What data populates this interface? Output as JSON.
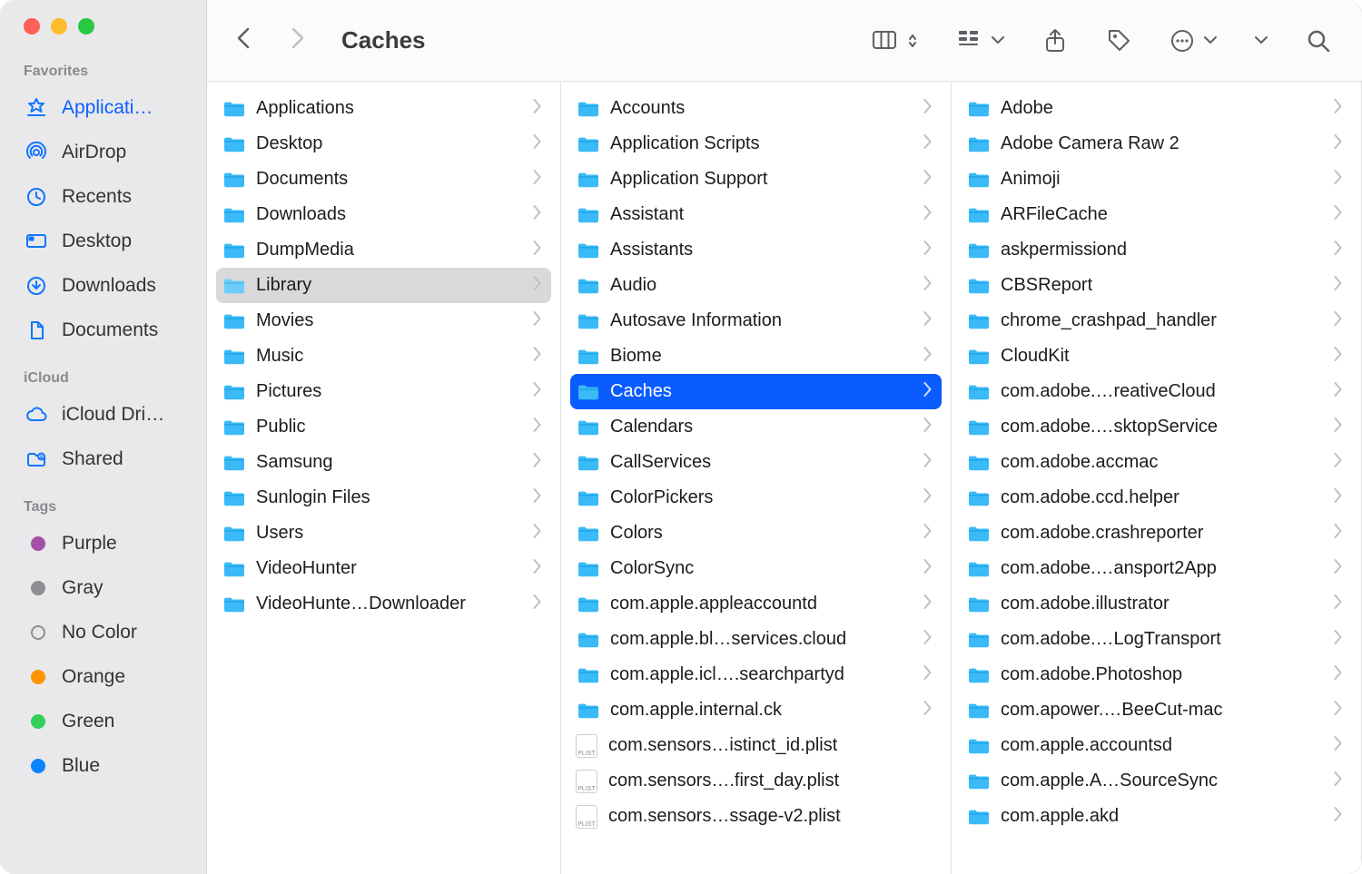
{
  "window": {
    "title": "Caches"
  },
  "colors": {
    "accent": "#0a5cff",
    "sidebar_icon": "#1276ff",
    "folder": "#3abaf7",
    "folder_shadow": "#12a0e6"
  },
  "sidebar": {
    "favorites_title": "Favorites",
    "favorites": [
      {
        "icon": "app-store",
        "label": "Applicati…",
        "selected": true
      },
      {
        "icon": "airdrop",
        "label": "AirDrop"
      },
      {
        "icon": "recents",
        "label": "Recents"
      },
      {
        "icon": "desktop",
        "label": "Desktop"
      },
      {
        "icon": "downloads",
        "label": "Downloads"
      },
      {
        "icon": "documents",
        "label": "Documents"
      }
    ],
    "icloud_title": "iCloud",
    "icloud": [
      {
        "icon": "cloud",
        "label": "iCloud Dri…"
      },
      {
        "icon": "shared",
        "label": "Shared"
      }
    ],
    "tags_title": "Tags",
    "tags": [
      {
        "color": "#a550a7",
        "label": "Purple"
      },
      {
        "color": "#8e8e93",
        "label": "Gray"
      },
      {
        "empty": true,
        "label": "No Color"
      },
      {
        "color": "#ff9500",
        "label": "Orange"
      },
      {
        "color": "#30d158",
        "label": "Green"
      },
      {
        "color": "#0a84ff",
        "label": "Blue"
      }
    ]
  },
  "columns": {
    "col1": [
      {
        "name": "Applications"
      },
      {
        "name": "Desktop"
      },
      {
        "name": "Documents"
      },
      {
        "name": "Downloads"
      },
      {
        "name": "DumpMedia"
      },
      {
        "name": "Library",
        "path_selected": true
      },
      {
        "name": "Movies"
      },
      {
        "name": "Music"
      },
      {
        "name": "Pictures"
      },
      {
        "name": "Public"
      },
      {
        "name": "Samsung"
      },
      {
        "name": "Sunlogin Files"
      },
      {
        "name": "Users"
      },
      {
        "name": "VideoHunter"
      },
      {
        "name": "VideoHunte…Downloader"
      }
    ],
    "col2": [
      {
        "name": "Accounts"
      },
      {
        "name": "Application Scripts"
      },
      {
        "name": "Application Support"
      },
      {
        "name": "Assistant"
      },
      {
        "name": "Assistants"
      },
      {
        "name": "Audio"
      },
      {
        "name": "Autosave Information"
      },
      {
        "name": "Biome"
      },
      {
        "name": "Caches",
        "active": true
      },
      {
        "name": "Calendars"
      },
      {
        "name": "CallServices"
      },
      {
        "name": "ColorPickers"
      },
      {
        "name": "Colors"
      },
      {
        "name": "ColorSync"
      },
      {
        "name": "com.apple.appleaccountd"
      },
      {
        "name": "com.apple.bl…services.cloud"
      },
      {
        "name": "com.apple.icl….searchpartyd"
      },
      {
        "name": "com.apple.internal.ck"
      },
      {
        "name": "com.sensors…istinct_id.plist",
        "kind": "file"
      },
      {
        "name": "com.sensors….first_day.plist",
        "kind": "file"
      },
      {
        "name": "com.sensors…ssage-v2.plist",
        "kind": "file"
      }
    ],
    "col3": [
      {
        "name": "Adobe"
      },
      {
        "name": "Adobe Camera Raw 2"
      },
      {
        "name": "Animoji"
      },
      {
        "name": "ARFileCache"
      },
      {
        "name": "askpermissiond"
      },
      {
        "name": "CBSReport"
      },
      {
        "name": "chrome_crashpad_handler"
      },
      {
        "name": "CloudKit"
      },
      {
        "name": "com.adobe.…reativeCloud"
      },
      {
        "name": "com.adobe.…sktopService"
      },
      {
        "name": "com.adobe.accmac"
      },
      {
        "name": "com.adobe.ccd.helper"
      },
      {
        "name": "com.adobe.crashreporter"
      },
      {
        "name": "com.adobe.…ansport2App"
      },
      {
        "name": "com.adobe.illustrator"
      },
      {
        "name": "com.adobe.…LogTransport"
      },
      {
        "name": "com.adobe.Photoshop"
      },
      {
        "name": "com.apower.…BeeCut-mac"
      },
      {
        "name": "com.apple.accountsd"
      },
      {
        "name": "com.apple.A…SourceSync"
      },
      {
        "name": "com.apple.akd"
      }
    ]
  }
}
